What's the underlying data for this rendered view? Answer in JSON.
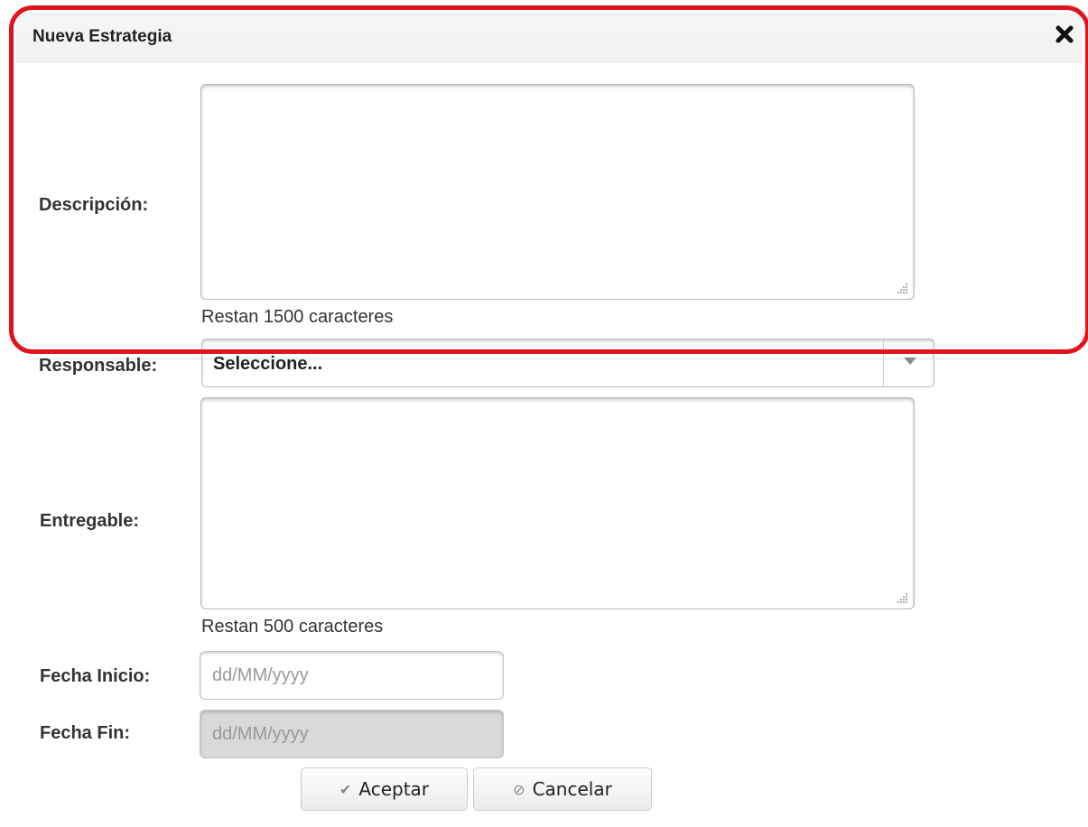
{
  "dialog": {
    "title": "Nueva Estrategia"
  },
  "fields": {
    "descripcion": {
      "label": "Descripción:",
      "value": "",
      "counter": "Restan 1500 caracteres"
    },
    "responsable": {
      "label": "Responsable:",
      "selected": "Seleccione..."
    },
    "entregable": {
      "label": "Entregable:",
      "value": "",
      "counter": "Restan 500 caracteres"
    },
    "fecha_inicio": {
      "label": "Fecha Inicio:",
      "placeholder": "dd/MM/yyyy"
    },
    "fecha_fin": {
      "label": "Fecha Fin:",
      "placeholder": "dd/MM/yyyy"
    }
  },
  "buttons": {
    "accept_label": "Aceptar",
    "cancel_label": "Cancelar"
  },
  "icons": {
    "close": "close-icon",
    "accept": "check-icon",
    "cancel": "cancel-icon",
    "select": "chevron-down-icon"
  },
  "colors": {
    "highlight": "#e0141c"
  }
}
